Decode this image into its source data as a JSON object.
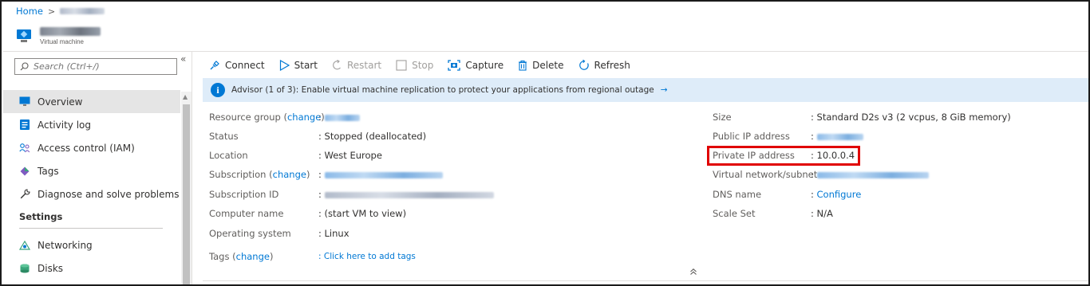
{
  "breadcrumb": {
    "home": "Home",
    "sep": ">"
  },
  "header": {
    "subtitle": "Virtual machine"
  },
  "search": {
    "placeholder": "Search (Ctrl+/)"
  },
  "sidebar": {
    "collapse_glyph": "«",
    "items": [
      {
        "label": "Overview",
        "icon": "monitor-icon",
        "active": true
      },
      {
        "label": "Activity log",
        "icon": "log-icon"
      },
      {
        "label": "Access control (IAM)",
        "icon": "people-icon"
      },
      {
        "label": "Tags",
        "icon": "tag-icon"
      },
      {
        "label": "Diagnose and solve problems",
        "icon": "wrench-icon"
      }
    ],
    "settings_title": "Settings",
    "settings_items": [
      {
        "label": "Networking",
        "icon": "network-icon"
      },
      {
        "label": "Disks",
        "icon": "disks-icon"
      }
    ]
  },
  "toolbar": {
    "connect": "Connect",
    "start": "Start",
    "restart": "Restart",
    "stop": "Stop",
    "capture": "Capture",
    "delete": "Delete",
    "refresh": "Refresh"
  },
  "advisor": {
    "text": "Advisor (1 of 3): Enable virtual machine replication to protect your applications from regional outage",
    "arrow": "→"
  },
  "essentials": {
    "left": [
      {
        "label": "Resource group",
        "change": "change",
        "value": ""
      },
      {
        "label": "Status",
        "value": ": Stopped (deallocated)"
      },
      {
        "label": "Location",
        "value": ": West Europe"
      },
      {
        "label": "Subscription",
        "change": "change",
        "value": ""
      },
      {
        "label": "Subscription ID",
        "value": ""
      },
      {
        "label": "Computer name",
        "value": ": (start VM to view)"
      },
      {
        "label": "Operating system",
        "value": ": Linux"
      },
      {
        "label": "Tags",
        "change": "change",
        "value": ": Click here to add tags"
      }
    ],
    "right": [
      {
        "label": "Size",
        "value": ": Standard D2s v3 (2 vcpus, 8 GiB memory)"
      },
      {
        "label": "Public IP address",
        "value": ":"
      },
      {
        "label": "Private IP address",
        "value": ": 10.0.0.4"
      },
      {
        "label": "Virtual network/subnet",
        "value": ":"
      },
      {
        "label": "DNS name",
        "colon": ":",
        "value": "Configure"
      },
      {
        "label": "Scale Set",
        "value": ": N/A"
      }
    ],
    "paren_open": "(",
    "paren_close": ")",
    "colon": ":"
  },
  "collapse_chevron": "«",
  "colors": {
    "accent": "#0078d4",
    "advisor_bg": "#deecf9",
    "highlight": "#e00000"
  }
}
